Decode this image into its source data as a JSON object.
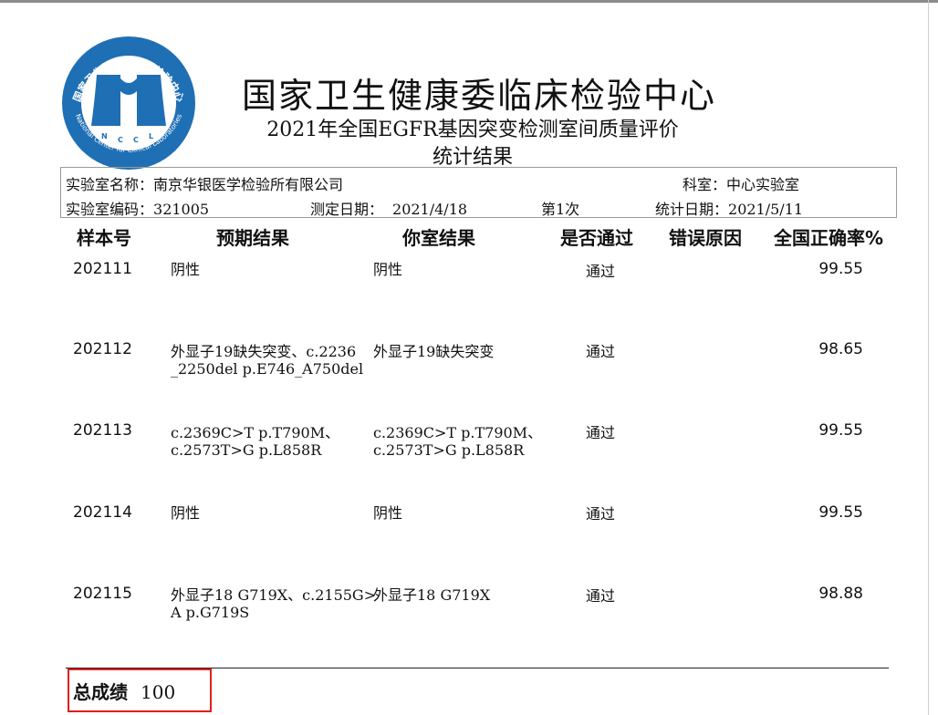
{
  "header": {
    "logo_text_top": "国家卫生健康委临床检验中心",
    "logo_text_bottom": "National Center for Clinical Laboratories",
    "logo_abbr": [
      "N",
      "C",
      "C",
      "L"
    ],
    "title": "国家卫生健康委临床检验中心",
    "subtitle": "2021年全国EGFR基因突变检测室间质量评价",
    "subtitle2": "统计结果"
  },
  "info": {
    "lab_name_label": "实验室名称：",
    "lab_name": "南京华银医学检验所有限公司",
    "dept_label": "科室：",
    "dept": "中心实验室",
    "lab_code_label": "实验室编码：",
    "lab_code": "321005",
    "test_date_label": "测定日期：",
    "test_date": "2021/4/18",
    "round": "第1次",
    "stat_date_label": "统计日期：",
    "stat_date": "2021/5/11"
  },
  "table": {
    "headers": [
      "样本号",
      "预期结果",
      "你室结果",
      "是否通过",
      "错误原因",
      "全国正确率%"
    ],
    "rows": [
      {
        "id": "202111",
        "expected": [
          "阴性"
        ],
        "yours": [
          "阴性"
        ],
        "pass": "通过",
        "reason": "",
        "rate": "99.55"
      },
      {
        "id": "202112",
        "expected": [
          "外显子19缺失突变、c.2236",
          "_2250del p.E746_A750del"
        ],
        "yours": [
          "外显子19缺失突变"
        ],
        "pass": "通过",
        "reason": "",
        "rate": "98.65"
      },
      {
        "id": "202113",
        "expected": [
          "c.2369C>T p.T790M、",
          "c.2573T>G p.L858R"
        ],
        "yours": [
          "c.2369C>T p.T790M、",
          "c.2573T>G p.L858R"
        ],
        "pass": "通过",
        "reason": "",
        "rate": "99.55"
      },
      {
        "id": "202114",
        "expected": [
          "阴性"
        ],
        "yours": [
          "阴性"
        ],
        "pass": "通过",
        "reason": "",
        "rate": "99.55"
      },
      {
        "id": "202115",
        "expected": [
          "外显子18 G719X、c.2155G>",
          "A p.G719S"
        ],
        "yours": [
          "外显子18 G719X"
        ],
        "pass": "通过",
        "reason": "",
        "rate": "98.88"
      }
    ]
  },
  "total": {
    "label": "总成绩",
    "value": "100"
  },
  "colors": {
    "logo_blue": "#1f6fb5",
    "highlight_red": "#e01f1f"
  }
}
